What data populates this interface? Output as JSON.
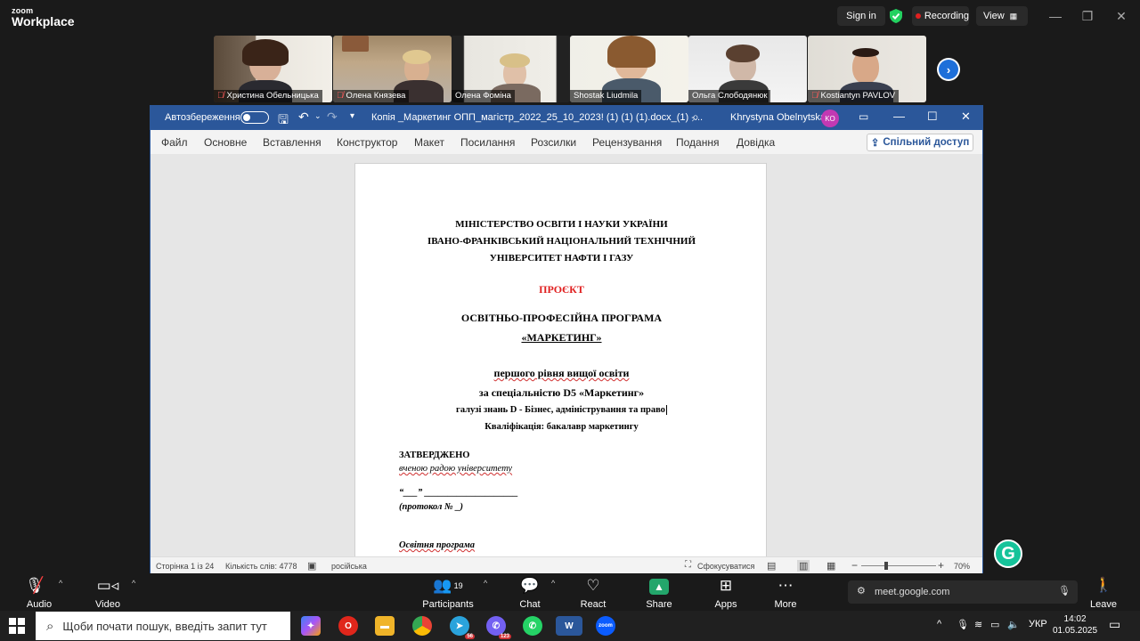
{
  "zoom": {
    "logo_top": "zoom",
    "logo_bottom": "Workplace",
    "signin": "Sign in",
    "recording": "Recording",
    "view": "View",
    "participants_tiles": [
      {
        "name": "Христина Обельницька",
        "muted": true
      },
      {
        "name": "Олена Князева",
        "muted": true
      },
      {
        "name": "Олена Фоміна",
        "muted": false
      },
      {
        "name": "Shostak Liudmila",
        "muted": false
      },
      {
        "name": "Ольга Слободянюк",
        "muted": false
      },
      {
        "name": "Kostiantyn PAVLOV",
        "muted": true
      }
    ],
    "toolbar": {
      "audio": "Audio",
      "video": "Video",
      "participants": "Participants",
      "participants_count": "19",
      "chat": "Chat",
      "react": "React",
      "share": "Share",
      "apps": "Apps",
      "more": "More",
      "leave": "Leave",
      "meet_url": "meet.google.com"
    }
  },
  "word": {
    "autosave": "Автозбереження",
    "filename": "Копія _Маркетинг ОПП_магістр_2022_25_10_2023! (1) (1) (1).docx_(1)  -...",
    "user": "Khrystyna Obelnytska",
    "user_initials": "KO",
    "menu": [
      "Файл",
      "Основне",
      "Вставлення",
      "Конструктор",
      "Макет",
      "Посилання",
      "Розсилки",
      "Рецензування",
      "Подання",
      "Довідка"
    ],
    "share": "Спільний доступ",
    "document": {
      "line1": "МІНІСТЕРСТВО ОСВІТИ І НАУКИ УКРАЇНИ",
      "line2": "ІВАНО-ФРАНКІВСЬКИЙ НАЦІОНАЛЬНИЙ ТЕХНІЧНИЙ",
      "line3": "УНІВЕРСИТЕТ НАФТИ І ГАЗУ",
      "project": "ПРОЄКТ",
      "program": "ОСВІТНЬО-ПРОФЕСІЙНА ПРОГРАМА",
      "program_name": "«МАРКЕТИНГ»",
      "level": "першого рівня вищої освіти",
      "specialty": "за спеціальністю D5 «Маркетинг»",
      "field": "галузі знань D - Бізнес, адміністрування та право",
      "qualification": "Кваліфікація: бакалавр маркетингу",
      "approved": "ЗАТВЕРДЖЕНО",
      "approved_by": "вченою радою університету",
      "date_line": "“___” ____________________",
      "protocol": "(протокол № _)",
      "edu_program": "Освітня програма"
    },
    "status": {
      "page": "Сторінка 1 із 24",
      "words": "Кількість слів: 4778",
      "language": "російська",
      "focus": "Сфокусуватися",
      "zoom": "70%"
    }
  },
  "taskbar": {
    "search_placeholder": "Щоби почати пошук, введіть запит тут",
    "lang": "УКР",
    "time": "14:02",
    "date": "01.05.2025",
    "telegram_badge": "56",
    "viber_badge": "123"
  }
}
